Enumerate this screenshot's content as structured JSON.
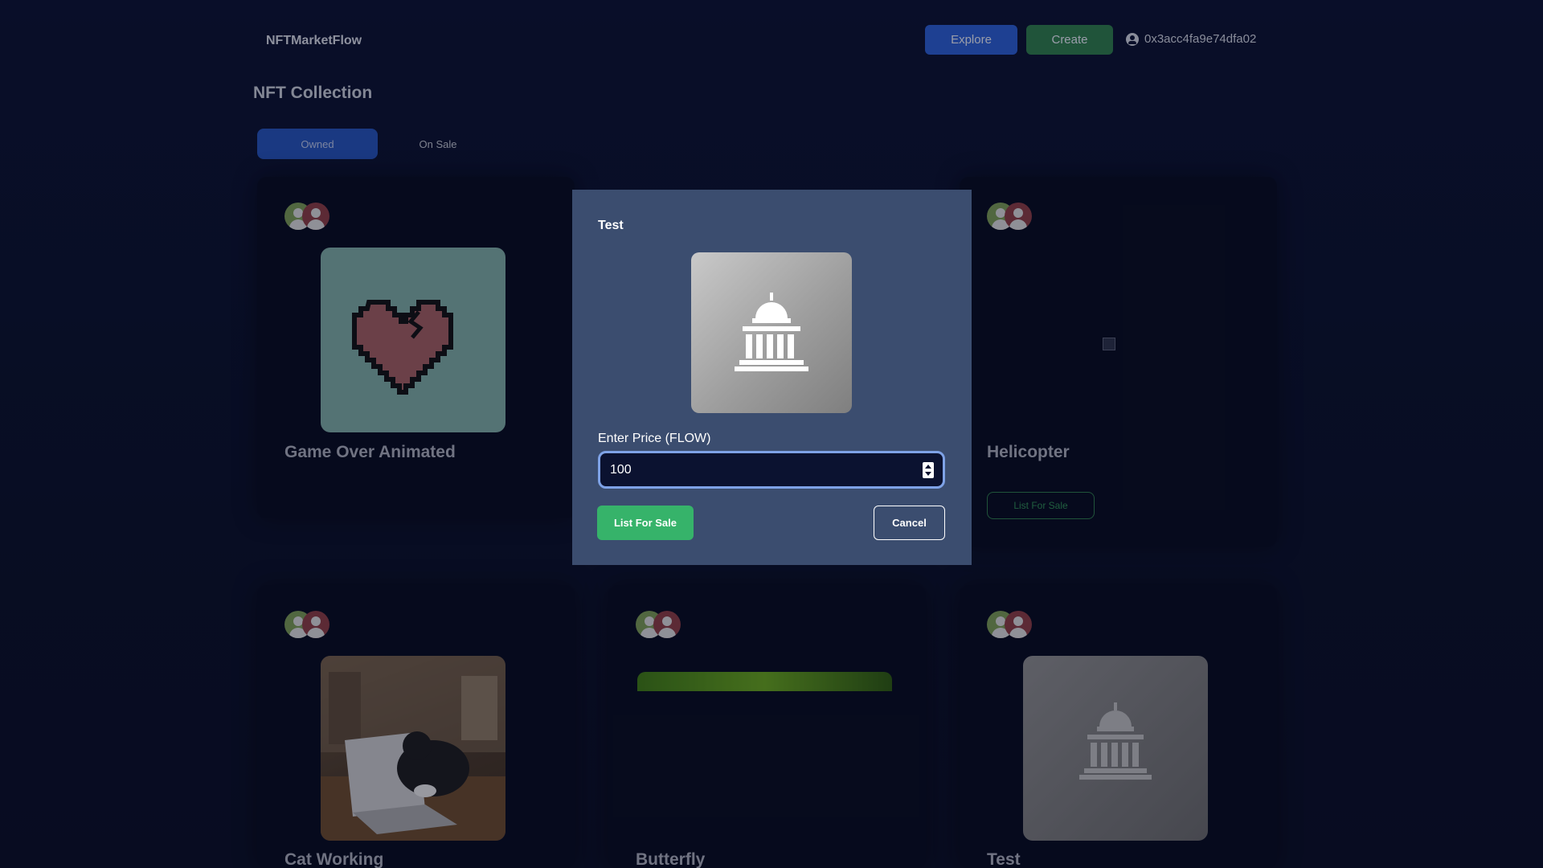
{
  "header": {
    "brand": "NFTMarketFlow",
    "nav": {
      "explore_label": "Explore",
      "create_label": "Create"
    },
    "wallet_address": "0x3acc4fa9e74dfa02"
  },
  "collection": {
    "title": "NFT Collection",
    "tabs": [
      {
        "label": "Owned",
        "active": true
      },
      {
        "label": "On Sale",
        "active": false
      }
    ],
    "cards": [
      {
        "title": "Game Over Animated",
        "image": "broken-heart-pixel-art"
      },
      {
        "title": "Helicopter",
        "image": "broken-image",
        "action_label": "List For Sale"
      },
      {
        "title": "Cat Working",
        "image": "cat-on-laptop-photo"
      },
      {
        "title": "Butterfly",
        "image": "butterfly-green-photo"
      },
      {
        "title": "Test",
        "image": "capitol-building-icon"
      }
    ]
  },
  "modal": {
    "title": "Test",
    "image": "capitol-building-icon",
    "price_label": "Enter Price (FLOW)",
    "price_value": "100",
    "list_button": "List For Sale",
    "cancel_button": "Cancel"
  },
  "colors": {
    "background": "#0a1028",
    "explore": "#2c5fd1",
    "create": "#2f7d4a",
    "modal": "#3b4d6f",
    "list_for_sale": "#36b36a"
  }
}
